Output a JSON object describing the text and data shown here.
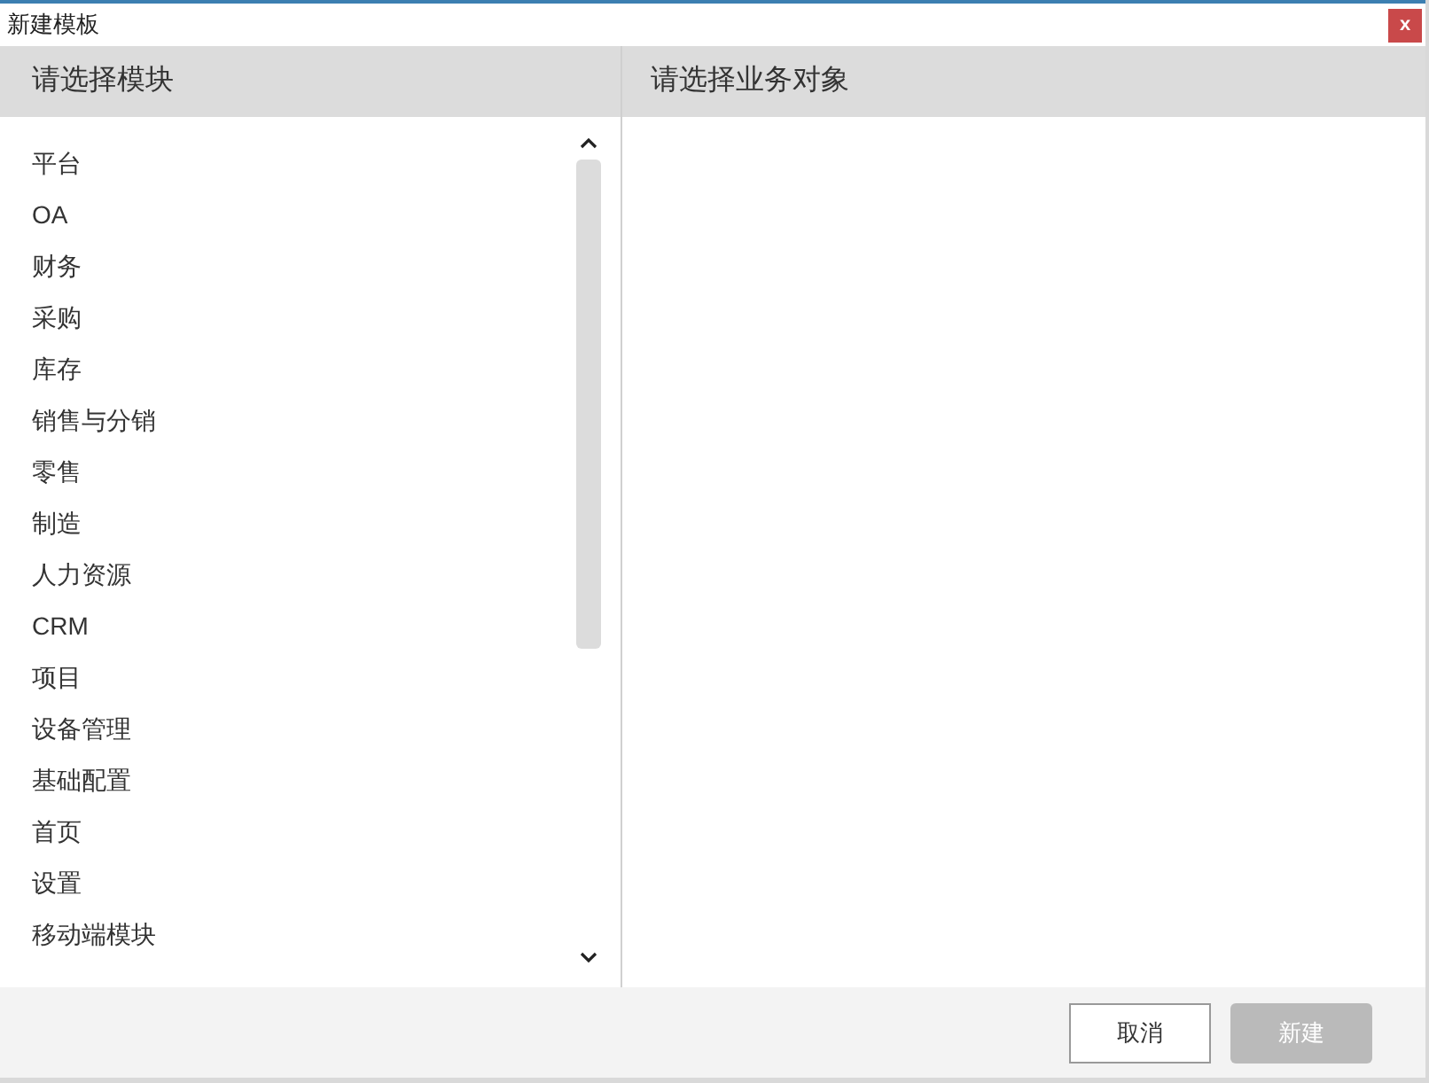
{
  "window": {
    "title": "新建模板",
    "close": "x"
  },
  "modules": {
    "header": "请选择模块",
    "items": [
      {
        "label": "平台",
        "selected": false
      },
      {
        "label": "OA",
        "selected": false
      },
      {
        "label": "财务",
        "selected": false
      },
      {
        "label": "采购",
        "selected": false
      },
      {
        "label": "库存",
        "selected": false
      },
      {
        "label": "销售与分销",
        "selected": false
      },
      {
        "label": "零售",
        "selected": false
      },
      {
        "label": "制造",
        "selected": false
      },
      {
        "label": "人力资源",
        "selected": false
      },
      {
        "label": "CRM",
        "selected": false
      },
      {
        "label": "项目",
        "selected": false
      },
      {
        "label": "设备管理",
        "selected": false
      },
      {
        "label": "基础配置",
        "selected": false
      },
      {
        "label": "首页",
        "selected": false
      },
      {
        "label": "设置",
        "selected": false
      },
      {
        "label": "移动端模块",
        "selected": false
      }
    ]
  },
  "objects": {
    "header": "请选择业务对象"
  },
  "buttons": [
    {
      "label": "取消",
      "disabled": false
    },
    {
      "label": "新建",
      "disabled": true
    }
  ]
}
